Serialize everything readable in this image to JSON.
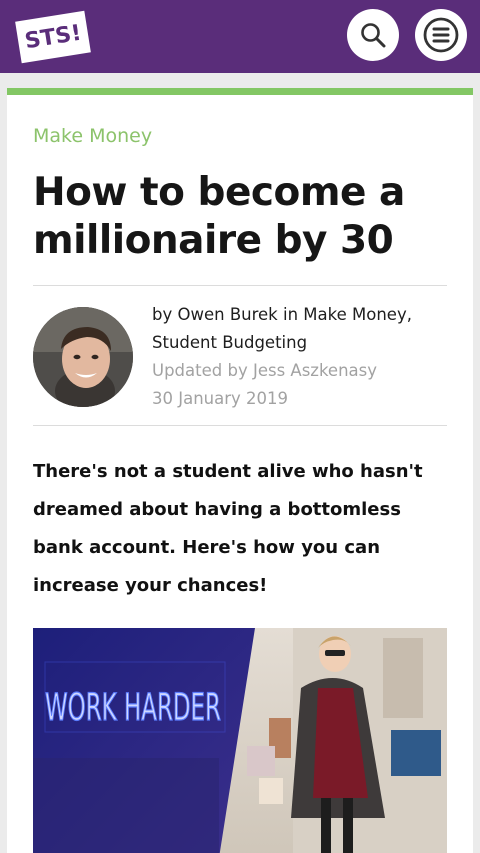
{
  "header": {
    "logo_text": "STS!",
    "search_icon": "search-icon",
    "menu_icon": "hamburger-menu-icon",
    "brand_color": "#5a2d7a"
  },
  "article": {
    "category": "Make Money",
    "category_color": "#8cc36b",
    "title": "How to become a millionaire by 30",
    "byline": {
      "by": "by",
      "author": "Owen Burek",
      "in": "in",
      "categories": "Make Money, Student Budgeting",
      "updated_by_label": "Updated by",
      "updated_by": "Jess Aszkenasy",
      "date": "30 January 2019"
    },
    "intro": "There's not a student alive who hasn't dreamed about having a bottomless bank account. Here's how you can increase your chances!",
    "hero_image": {
      "neon_text": "WORK HARDER"
    }
  }
}
